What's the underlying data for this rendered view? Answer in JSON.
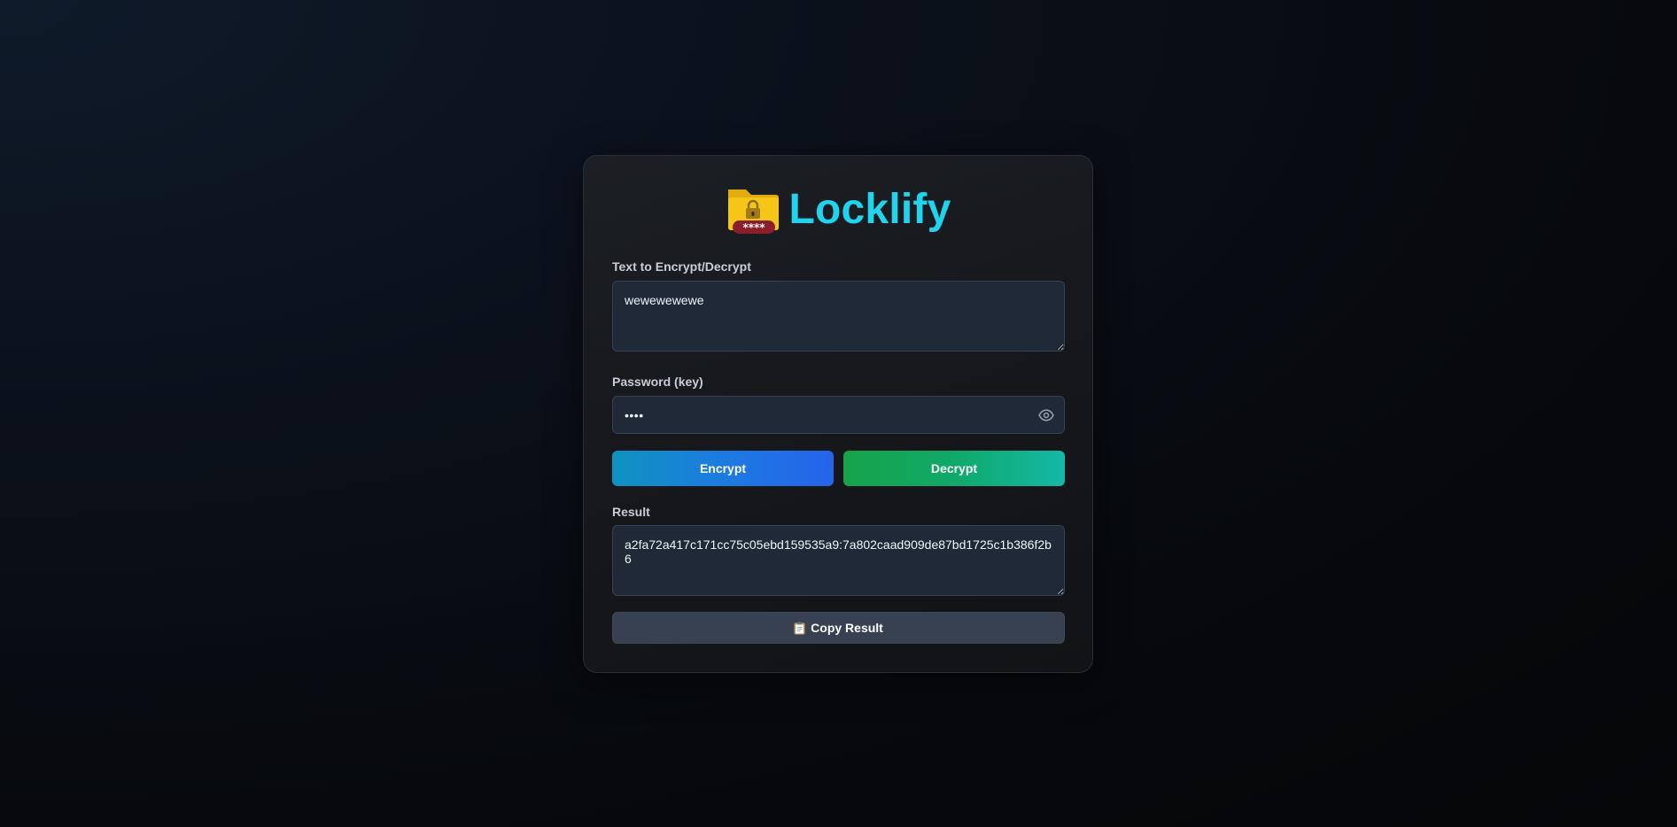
{
  "app": {
    "title": "Locklify",
    "logo_icon": "locked-folder-icon",
    "accent_color": "#22d3ee"
  },
  "form": {
    "text_label": "Text to Encrypt/Decrypt",
    "text_value": "wewewewewe",
    "password_label": "Password (key)",
    "password_value": "••••",
    "password_toggle_icon": "eye-icon",
    "encrypt_label": "Encrypt",
    "decrypt_label": "Decrypt",
    "result_label": "Result",
    "result_value": "a2fa72a417c171cc75c05ebd159535a9:7a802caad909de87bd1725c1b386f2b6",
    "copy_label": "Copy Result",
    "copy_icon": "clipboard-icon"
  },
  "colors": {
    "encrypt_gradient": [
      "#0e93c0",
      "#2563eb"
    ],
    "decrypt_gradient": [
      "#16a34a",
      "#14b8a6"
    ],
    "field_bg": "#1f2937",
    "copy_bg": "#374151"
  }
}
